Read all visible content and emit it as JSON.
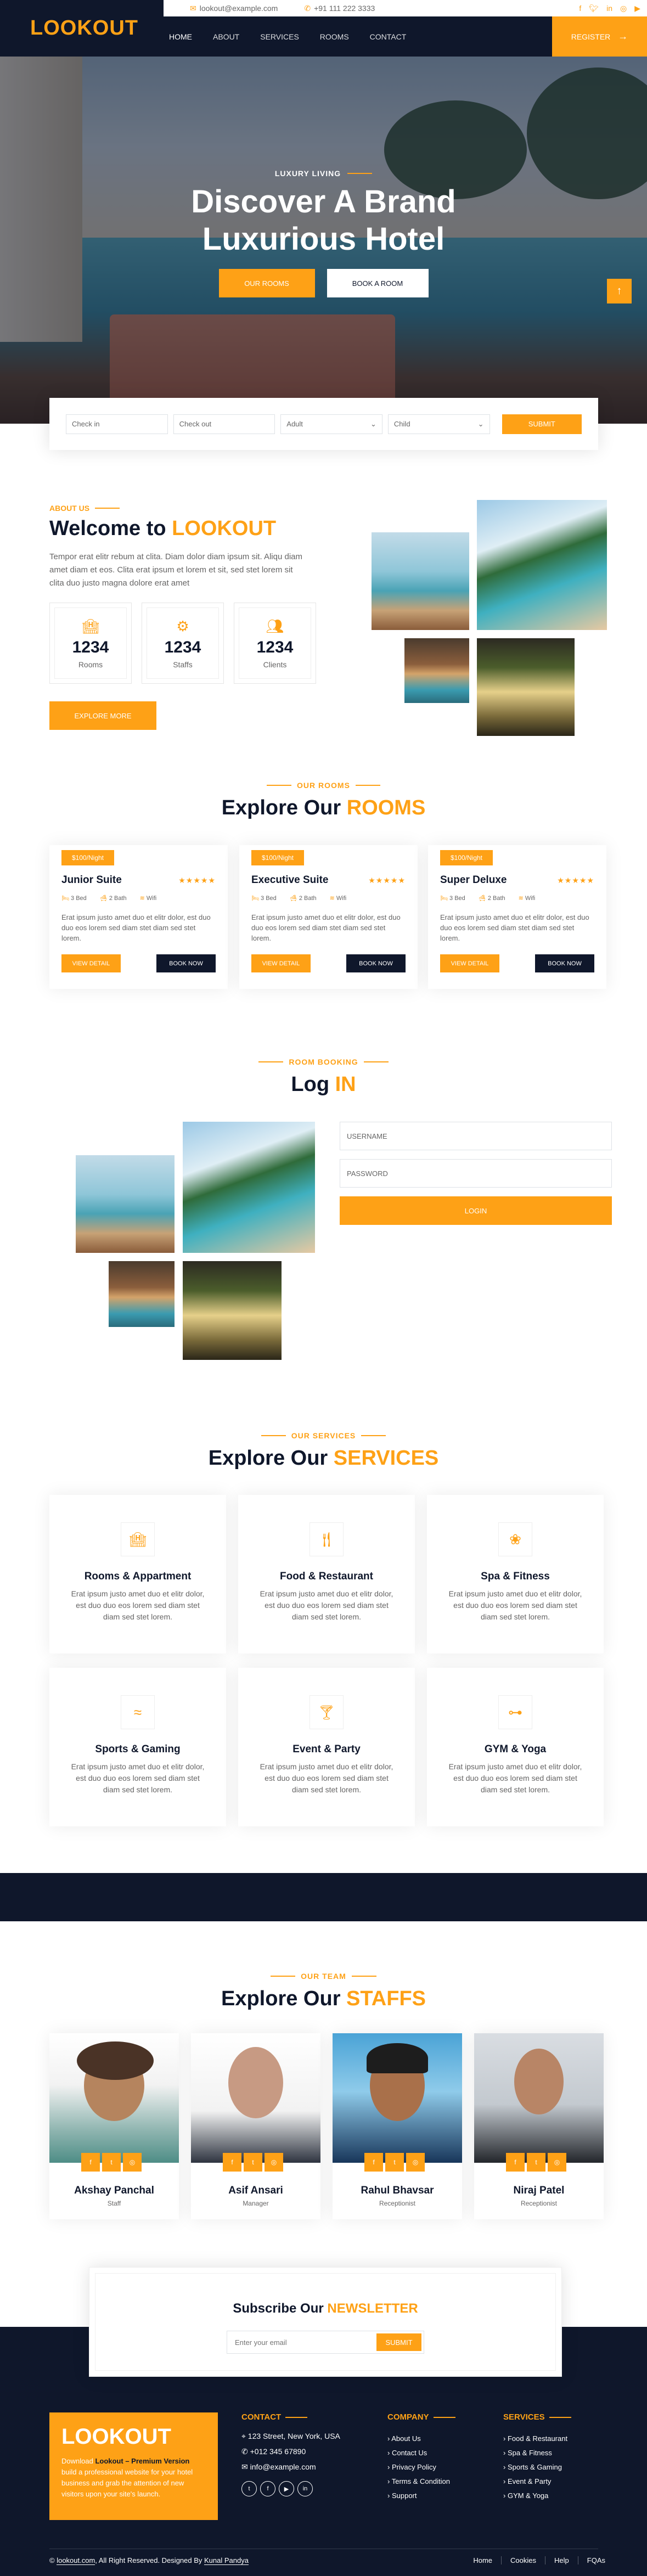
{
  "header": {
    "logo": "LOOKOUT",
    "email": "lookout@example.com",
    "phone": "+91 111 222 3333",
    "nav": [
      "HOME",
      "ABOUT",
      "SERVICES",
      "ROOMS",
      "CONTACT"
    ],
    "register": "REGISTER"
  },
  "hero": {
    "eyebrow": "LUXURY LIVING",
    "title_line1": "Discover A Brand",
    "title_line2": "Luxurious Hotel",
    "btn_rooms": "OUR ROOMS",
    "btn_book": "BOOK A ROOM"
  },
  "booking": {
    "checkin": "Check in",
    "checkout": "Check out",
    "adult": "Adult",
    "child": "Child",
    "submit": "SUBMIT"
  },
  "about": {
    "eyebrow": "ABOUT US",
    "title_a": "Welcome to ",
    "title_b": "LOOKOUT",
    "text": "Tempor erat elitr rebum at clita. Diam dolor diam ipsum sit. Aliqu diam amet diam et eos. Clita erat ipsum et lorem et sit, sed stet lorem sit clita duo justo magna dolore erat amet",
    "stats": [
      {
        "value": "1234",
        "label": "Rooms"
      },
      {
        "value": "1234",
        "label": "Staffs"
      },
      {
        "value": "1234",
        "label": "Clients"
      }
    ],
    "btn": "EXPLORE MORE"
  },
  "rooms": {
    "eyebrow": "OUR ROOMS",
    "title_a": "Explore Our ",
    "title_b": "ROOMS",
    "items": [
      {
        "price": "$100/Night",
        "name": "Junior Suite",
        "bed": "3 Bed",
        "bath": "2 Bath",
        "wifi": "Wifi",
        "desc": "Erat ipsum justo amet duo et elitr dolor, est duo duo eos lorem sed diam stet diam sed stet lorem.",
        "detail": "VIEW DETAIL",
        "book": "BOOK NOW"
      },
      {
        "price": "$100/Night",
        "name": "Executive Suite",
        "bed": "3 Bed",
        "bath": "2 Bath",
        "wifi": "Wifi",
        "desc": "Erat ipsum justo amet duo et elitr dolor, est duo duo eos lorem sed diam stet diam sed stet lorem.",
        "detail": "VIEW DETAIL",
        "book": "BOOK NOW"
      },
      {
        "price": "$100/Night",
        "name": "Super Deluxe",
        "bed": "3 Bed",
        "bath": "2 Bath",
        "wifi": "Wifi",
        "desc": "Erat ipsum justo amet duo et elitr dolor, est duo duo eos lorem sed diam stet diam sed stet lorem.",
        "detail": "VIEW DETAIL",
        "book": "BOOK NOW"
      }
    ]
  },
  "login": {
    "eyebrow": "ROOM BOOKING",
    "title_a": "Log ",
    "title_b": "IN",
    "username": "USERNAME",
    "password": "PASSWORD",
    "btn": "LOGIN"
  },
  "services": {
    "eyebrow": "OUR SERVICES",
    "title_a": "Explore Our ",
    "title_b": "SERVICES",
    "desc": "Erat ipsum justo amet duo et elitr dolor, est duo duo eos lorem sed diam stet diam sed stet lorem.",
    "items": [
      {
        "name": "Rooms & Appartment",
        "icon": "hotel-icon"
      },
      {
        "name": "Food & Restaurant",
        "icon": "utensils-icon"
      },
      {
        "name": "Spa & Fitness",
        "icon": "spa-icon"
      },
      {
        "name": "Sports & Gaming",
        "icon": "swimmer-icon"
      },
      {
        "name": "Event & Party",
        "icon": "cocktail-icon"
      },
      {
        "name": "GYM & Yoga",
        "icon": "dumbbell-icon"
      }
    ]
  },
  "team": {
    "eyebrow": "OUR TEAM",
    "title_a": "Explore Our ",
    "title_b": "STAFFS",
    "members": [
      {
        "name": "Akshay Panchal",
        "role": "Staff"
      },
      {
        "name": "Asif Ansari",
        "role": "Manager"
      },
      {
        "name": "Rahul Bhavsar",
        "role": "Receptionist"
      },
      {
        "name": "Niraj Patel",
        "role": "Receptionist"
      }
    ]
  },
  "newsletter": {
    "title_a": "Subscribe Our ",
    "title_b": "NEWSLETTER",
    "placeholder": "Enter your email",
    "btn": "SUBMIT"
  },
  "footer": {
    "logo": "LOOKOUT",
    "blurb_a": "Download ",
    "blurb_b": "Lookout – Premium Version",
    "blurb_c": " build a professional website for your hotel business and grab the attention of new visitors upon your site's launch.",
    "contact_h": "CONTACT",
    "address": "123 Street, New York, USA",
    "phone": "+012 345 67890",
    "email": "info@example.com",
    "company_h": "COMPANY",
    "company": [
      "About Us",
      "Contact Us",
      "Privacy Policy",
      "Terms & Condition",
      "Support"
    ],
    "services_h": "SERVICES",
    "services": [
      "Food & Restaurant",
      "Spa & Fitness",
      "Sports & Gaming",
      "Event & Party",
      "GYM & Yoga"
    ],
    "copyright_a": "© ",
    "copyright_site": "lookout.com",
    "copyright_b": ", All Right Reserved. Designed By ",
    "copyright_author": "Kunal Pandya",
    "links": [
      "Home",
      "Cookies",
      "Help",
      "FQAs"
    ]
  },
  "colors": {
    "accent": "#FEA116",
    "dark": "#0F172B"
  }
}
